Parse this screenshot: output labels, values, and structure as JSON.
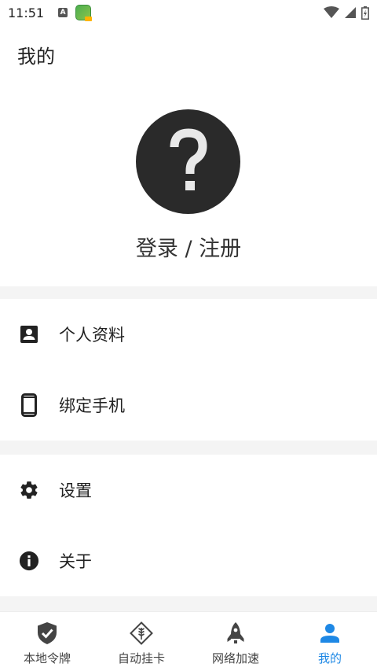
{
  "status_bar": {
    "time": "11:51",
    "a_badge": "A",
    "icons": [
      "a-badge-icon",
      "app-notification-icon",
      "wifi-icon",
      "signal-icon",
      "battery-icon"
    ]
  },
  "header": {
    "title": "我的"
  },
  "profile": {
    "avatar_icon": "question-mark-icon",
    "login_label": "登录 / 注册"
  },
  "menu": {
    "profile_label": "个人资料",
    "bind_phone_label": "绑定手机",
    "settings_label": "设置",
    "about_label": "关于"
  },
  "bottom_nav": {
    "items": [
      {
        "label": "本地令牌",
        "icon": "shield-check-icon",
        "active": false
      },
      {
        "label": "自动挂卡",
        "icon": "wheat-diamond-icon",
        "active": false
      },
      {
        "label": "网络加速",
        "icon": "rocket-icon",
        "active": false
      },
      {
        "label": "我的",
        "icon": "person-icon",
        "active": true
      }
    ]
  },
  "colors": {
    "accent": "#1e88e5",
    "avatar_bg": "#2a2a2a",
    "band": "#f4f4f4"
  }
}
